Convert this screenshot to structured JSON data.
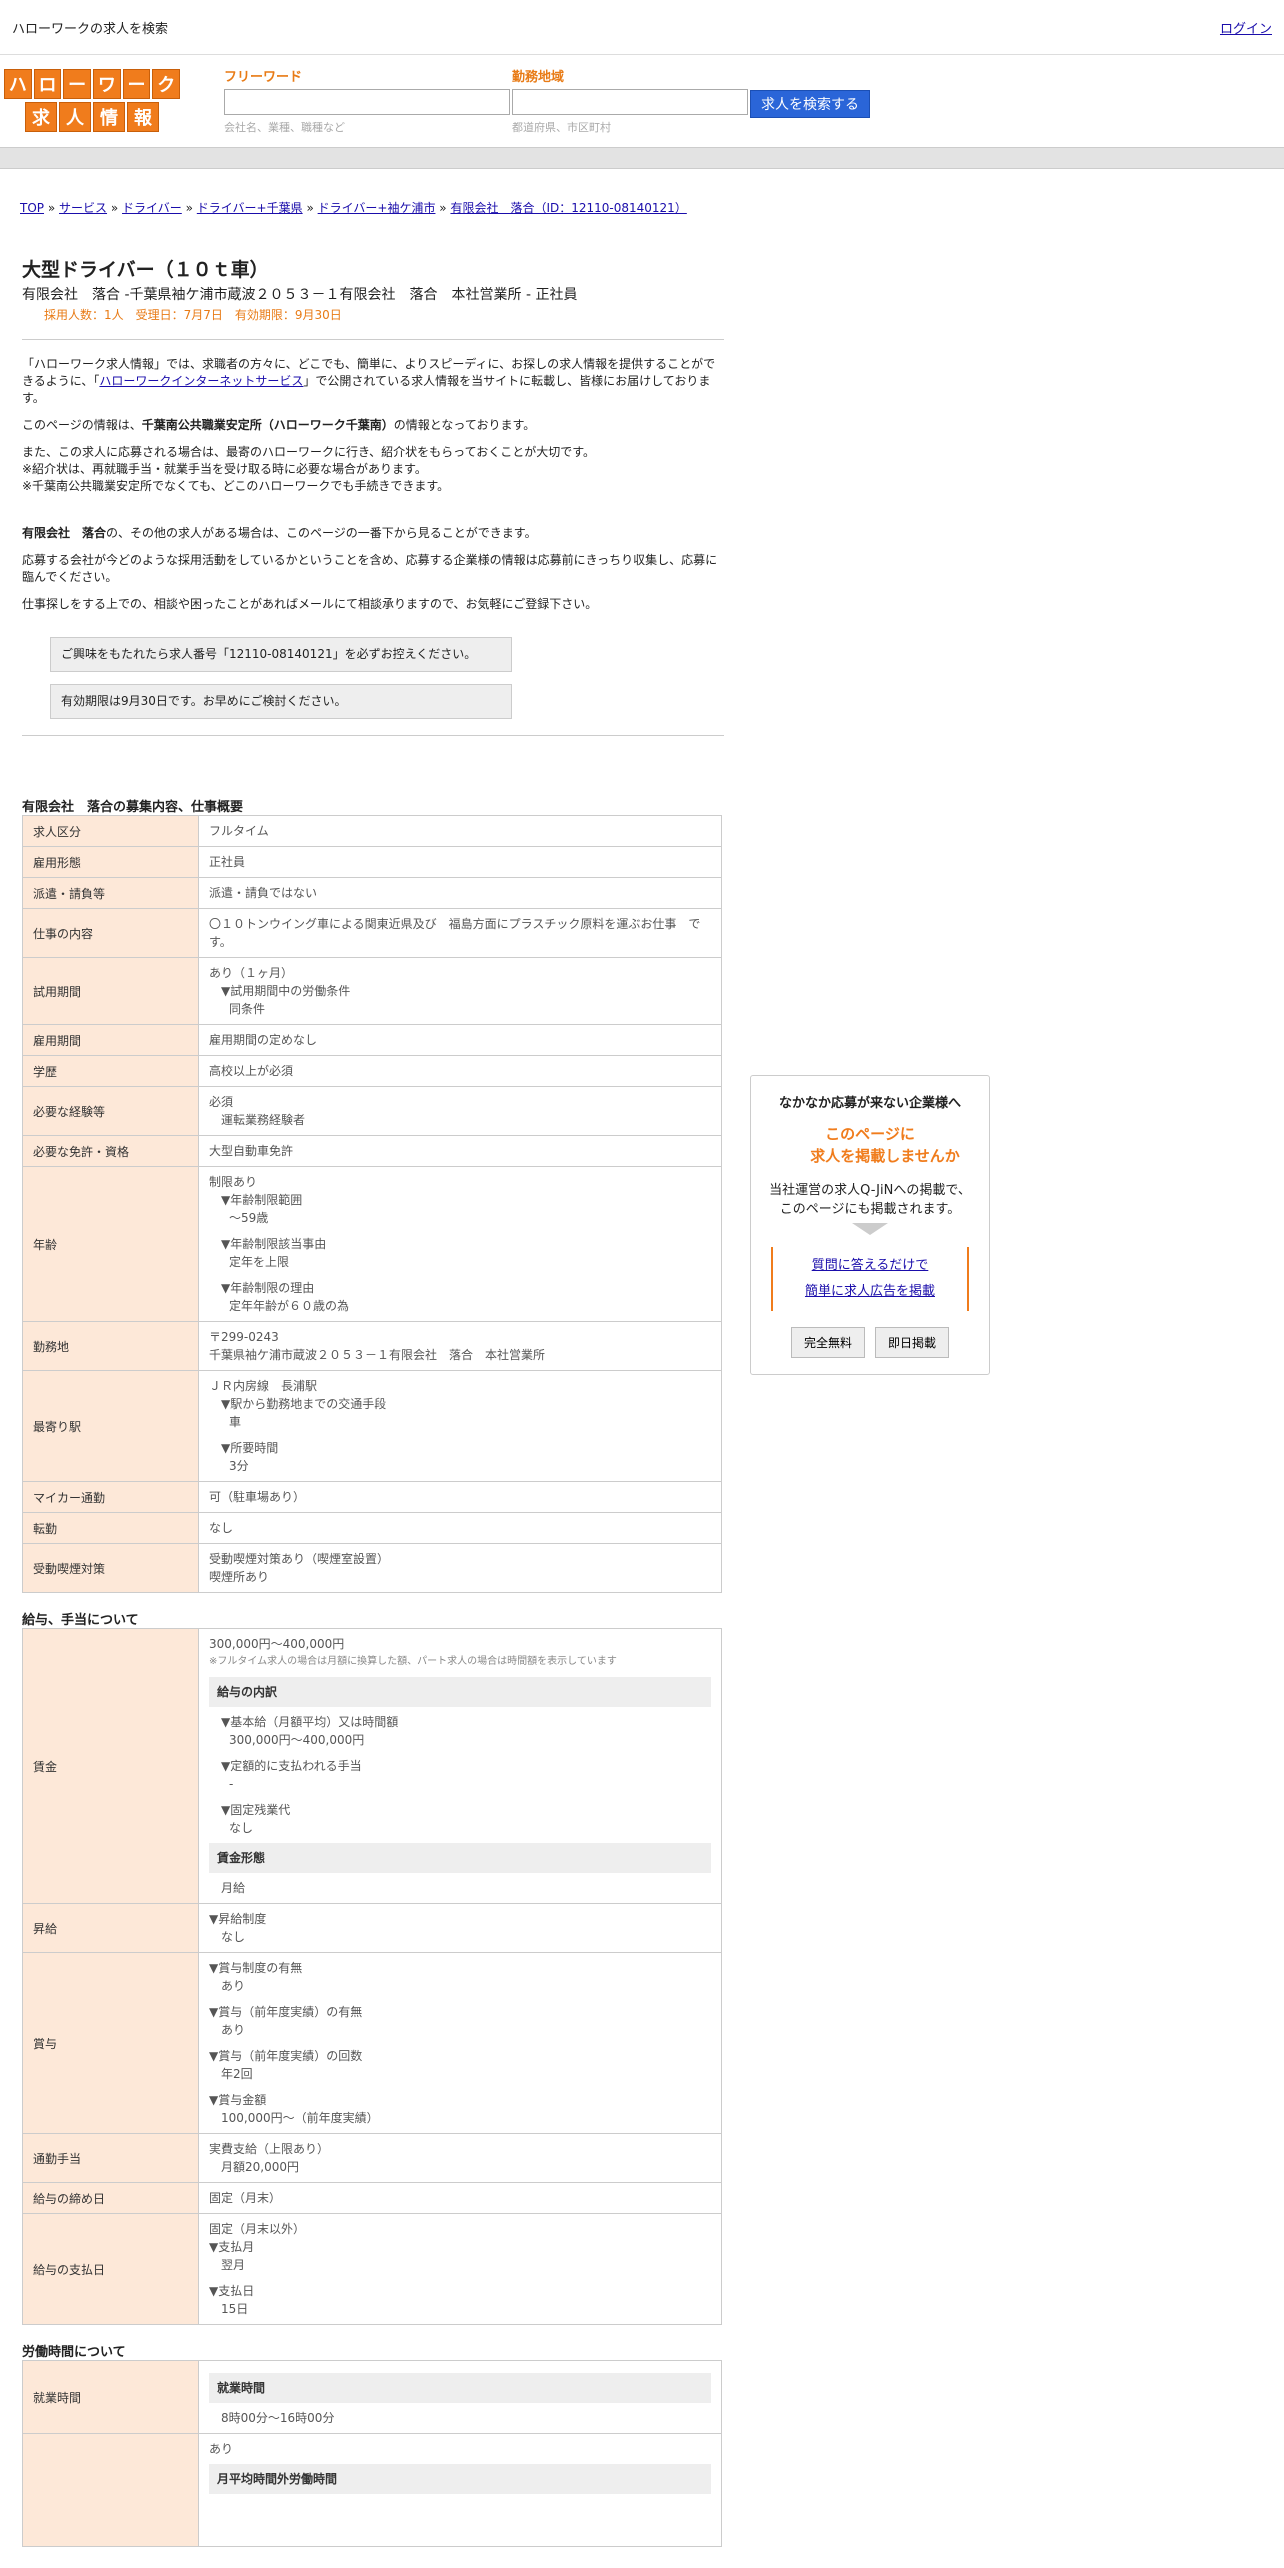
{
  "topbar": {
    "title": "ハローワークの求人を検索",
    "login": "ログイン"
  },
  "logo": {
    "row1": [
      "ハ",
      "ロ",
      "ー",
      "ワ",
      "ー",
      "ク"
    ],
    "row2": [
      "求",
      "人",
      "情",
      "報"
    ]
  },
  "search": {
    "freeword_label": "フリーワード",
    "freeword_placeholder": "会社名、業種、職種など",
    "area_label": "勤務地域",
    "area_placeholder": "都道府県、市区町村",
    "button": "求人を検索する"
  },
  "breadcrumb": {
    "items": [
      "TOP",
      "サービス",
      "ドライバー",
      "ドライバー+千葉県",
      "ドライバー+袖ケ浦市",
      "有限会社　落合（ID：12110-08140121）"
    ],
    "sep": "»"
  },
  "job": {
    "title": "大型ドライバー（１０ｔ車）",
    "company_line": "有限会社　落合 -千葉県袖ケ浦市蔵波２０５３－１有限会社　落合　本社営業所 - 正社員",
    "meta": "採用人数：1人　受理日：7月7日　有効期限：9月30日"
  },
  "intro": {
    "p1a": "「ハローワーク求人情報」では、求職者の方々に、どこでも、簡単に、よりスピーディに、お探しの求人情報を提供することができるように、「",
    "p1link": "ハローワークインターネットサービス",
    "p1b": "」で公開されている求人情報を当サイトに転載し、皆様にお届けしております。",
    "p2a": "このページの情報は、",
    "p2b": "千葉南公共職業安定所（ハローワーク千葉南）",
    "p2c": "の情報となっております。",
    "p3": "また、この求人に応募される場合は、最寄のハローワークに行き、紹介状をもらっておくことが大切です。",
    "p4": "※紹介状は、再就職手当・就業手当を受け取る時に必要な場合があります。",
    "p5": "※千葉南公共職業安定所でなくても、どこのハローワークでも手続きできます。",
    "p6a": "有限会社　落合",
    "p6b": "の、その他の求人がある場合は、このページの一番下から見ることができます。",
    "p7": "応募する会社が今どのような採用活動をしているかということを含め、応募する企業様の情報は応募前にきっちり収集し、応募に臨んでください。",
    "p8": "仕事探しをする上での、相談や困ったことがあればメールにて相談承りますので、お気軽にご登録下さい。"
  },
  "notices": {
    "n1": "ご興味をもたれたら求人番号「12110-08140121」を必ずお控えください。",
    "n2": "有効期限は9月30日です。お早めにご検討ください。"
  },
  "section1": {
    "title": "有限会社　落合の募集内容、仕事概要",
    "rows": [
      {
        "k": "求人区分",
        "v": "フルタイム"
      },
      {
        "k": "雇用形態",
        "v": "正社員"
      },
      {
        "k": "派遣・請負等",
        "v": "派遣・請負ではない"
      },
      {
        "k": "仕事の内容",
        "v": "〇１０トンウイング車による関東近県及び　福島方面にプラスチック原料を運ぶお仕事　です。"
      },
      {
        "k": "試用期間",
        "v1": "あり（１ヶ月）",
        "v2": "▼試用期間中の労働条件",
        "v3": "同条件"
      },
      {
        "k": "雇用期間",
        "v": "雇用期間の定めなし"
      },
      {
        "k": "学歴",
        "v": "高校以上が必須"
      },
      {
        "k": "必要な経験等",
        "v1": "必須",
        "v2": "運転業務経験者"
      },
      {
        "k": "必要な免許・資格",
        "v": "大型自動車免許"
      },
      {
        "k": "年齢",
        "v1": "制限あり",
        "v2": "▼年齢制限範囲",
        "v3": "〜59歳",
        "v4": "▼年齢制限該当事由",
        "v5": "定年を上限",
        "v6": "▼年齢制限の理由",
        "v7": "定年年齢が６０歳の為"
      },
      {
        "k": "勤務地",
        "v1": "〒299-0243",
        "v2": "千葉県袖ケ浦市蔵波２０５３－１有限会社　落合　本社営業所"
      },
      {
        "k": "最寄り駅",
        "v1": "ＪＲ内房線　長浦駅",
        "v2": "▼駅から勤務地までの交通手段",
        "v3": "車",
        "v4": "▼所要時間",
        "v5": "3分"
      },
      {
        "k": "マイカー通勤",
        "v": "可（駐車場あり）"
      },
      {
        "k": "転勤",
        "v": "なし"
      },
      {
        "k": "受動喫煙対策",
        "v1": "受動喫煙対策あり（喫煙室設置）",
        "v2": "喫煙所あり"
      }
    ]
  },
  "section2": {
    "title": "給与、手当について",
    "wage": {
      "k": "賃金",
      "v1": "300,000円〜400,000円",
      "note": "※フルタイム求人の場合は月額に換算した額、パート求人の場合は時間額を表示しています",
      "sub1": "給与の内訳",
      "a1": "▼基本給（月額平均）又は時間額",
      "a2": "300,000円〜400,000円",
      "a3": "▼定額的に支払われる手当",
      "a4": "-",
      "a5": "▼固定残業代",
      "a6": "なし",
      "sub2": "賃金形態",
      "a7": "月給"
    },
    "raise": {
      "k": "昇給",
      "v1": "▼昇給制度",
      "v2": "なし"
    },
    "bonus": {
      "k": "賞与",
      "v1": "▼賞与制度の有無",
      "v2": "あり",
      "v3": "▼賞与（前年度実績）の有無",
      "v4": "あり",
      "v5": "▼賞与（前年度実績）の回数",
      "v6": "年2回",
      "v7": "▼賞与金額",
      "v8": "100,000円〜（前年度実績）"
    },
    "commute": {
      "k": "通勤手当",
      "v1": "実費支給（上限あり）",
      "v2": "月額20,000円"
    },
    "closing": {
      "k": "給与の締め日",
      "v": "固定（月末）"
    },
    "payday": {
      "k": "給与の支払日",
      "v1": "固定（月末以外）",
      "v2": "▼支払月",
      "v3": "翌月",
      "v4": "▼支払日",
      "v5": "15日"
    }
  },
  "section3": {
    "title": "労働時間について",
    "hours": {
      "k": "就業時間",
      "sub": "就業時間",
      "v": "8時00分〜16時00分"
    },
    "overtime": {
      "v1": "あり",
      "sub": "月平均時間外労働時間"
    }
  },
  "side": {
    "title": "なかなか応募が来ない企業様へ",
    "big1": "このページに",
    "big2": "求人を掲載しませんか",
    "desc1": "当社運営の求人Q-JiNへの掲載で、",
    "desc2": "このページにも掲載されます。",
    "link1": "質問に答えるだけで",
    "link2": "簡単に求人広告を掲載",
    "btn1": "完全無料",
    "btn2": "即日掲載"
  }
}
